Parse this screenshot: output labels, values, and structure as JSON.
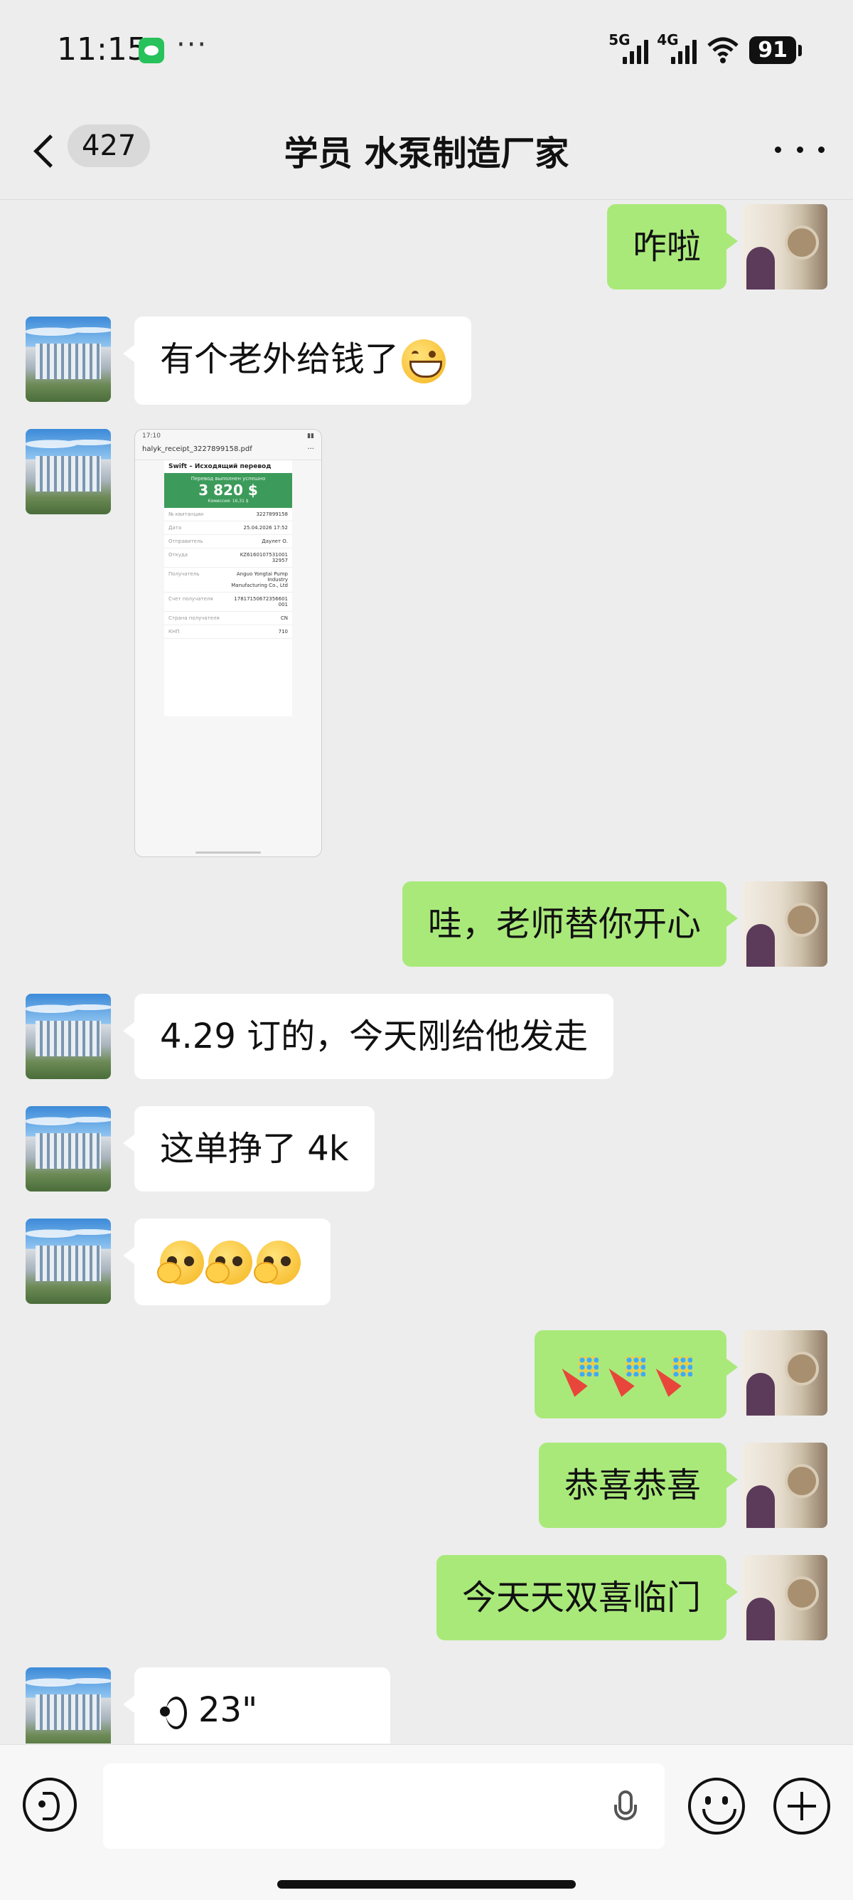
{
  "status_bar": {
    "time": "11:15",
    "app_icon": "wechat-icon",
    "more": "···",
    "signal_1": "5G",
    "signal_2": "4G",
    "wifi_icon": "wifi-icon",
    "battery": "91"
  },
  "header": {
    "unread_count": "427",
    "title": "学员 水泵制造厂家",
    "back_icon": "chevron-left-icon",
    "more_icon": "more-icon"
  },
  "messages": [
    {
      "side": "out",
      "text": "咋啦"
    },
    {
      "side": "in",
      "text": "有个老外给钱了",
      "emoji": "grinning-face"
    },
    {
      "side": "in",
      "type": "image",
      "receipt": {
        "status_time": "17:10",
        "filename": "halyk_receipt_3227899158.pdf",
        "doc_title": "Swift – Исходящий перевод",
        "status_text": "Перевод выполнен успешно",
        "amount": "3 820 $",
        "fee": "Комиссия: 16,31 $",
        "rows": [
          {
            "k": "№ квитанции",
            "v": "3227899158"
          },
          {
            "k": "Дата",
            "v": "25.04.2026 17:52"
          },
          {
            "k": "Отправитель",
            "v": "Даулет О."
          },
          {
            "k": "Откуда",
            "v": "KZ616010753100132957"
          },
          {
            "k": "Получатель",
            "v": "Anguo Yongtai Pump Industry Manufacturing Co., Ltd"
          },
          {
            "k": "Счет получателя",
            "v": "17817150672356601001"
          },
          {
            "k": "Страна получателя",
            "v": "CN"
          },
          {
            "k": "КНП",
            "v": "710"
          }
        ]
      }
    },
    {
      "side": "out",
      "text": "哇，老师替你开心"
    },
    {
      "side": "in",
      "text": "4.29 订的，今天刚给他发走"
    },
    {
      "side": "in",
      "text": "这单挣了 4k"
    },
    {
      "side": "in",
      "type": "emoji",
      "emoji": "face-with-monocle-hand",
      "count": 3
    },
    {
      "side": "out",
      "type": "emoji",
      "emoji": "party-popper",
      "count": 3
    },
    {
      "side": "out",
      "text": "恭喜恭喜"
    },
    {
      "side": "out",
      "text": "今天天双喜临门"
    },
    {
      "side": "in",
      "type": "voice",
      "duration": "23\""
    }
  ],
  "input_bar": {
    "voice_icon": "voice-mode-icon",
    "mic_icon": "microphone-icon",
    "emoji_icon": "emoji-icon",
    "plus_icon": "plus-icon"
  }
}
